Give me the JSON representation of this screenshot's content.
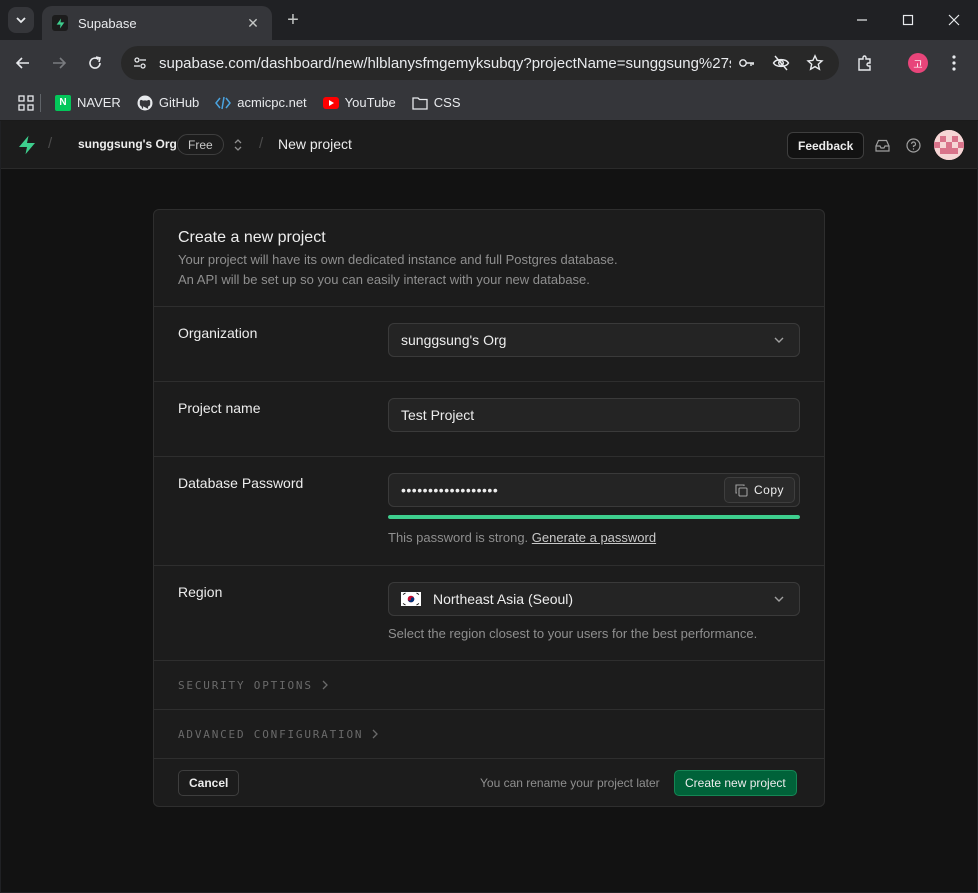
{
  "browser": {
    "tab_title": "Supabase",
    "url": "supabase.com/dashboard/new/hlblanysfmgemyksubqy?projectName=sunggsung%27s%...",
    "profile_initial": "고",
    "bookmarks": [
      {
        "label": "NAVER",
        "icon": "naver-icon"
      },
      {
        "label": "GitHub",
        "icon": "github-icon"
      },
      {
        "label": "acmicpc.net",
        "icon": "code-icon"
      },
      {
        "label": "YouTube",
        "icon": "youtube-icon"
      },
      {
        "label": "CSS",
        "icon": "folder-icon"
      }
    ],
    "naver_glyph": "N"
  },
  "header": {
    "org_name": "sunggsung's Org",
    "plan_badge": "Free",
    "page": "New project",
    "feedback_label": "Feedback"
  },
  "form": {
    "title": "Create a new project",
    "description_line1": "Your project will have its own dedicated instance and full Postgres database.",
    "description_line2": "An API will be set up so you can easily interact with your new database.",
    "organization": {
      "label": "Organization",
      "value": "sunggsung's Org"
    },
    "project_name": {
      "label": "Project name",
      "value": "Test Project"
    },
    "password": {
      "label": "Database Password",
      "masked_value": "••••••••••••••••••",
      "copy_label": "Copy",
      "strength_fraction": 1.0,
      "strength_text": "This password is strong.",
      "generate_link": "Generate a password"
    },
    "region": {
      "label": "Region",
      "value": "Northeast Asia (Seoul)",
      "hint": "Select the region closest to your users for the best performance."
    },
    "security_options": "SECURITY OPTIONS",
    "advanced_configuration": "ADVANCED CONFIGURATION",
    "cancel_label": "Cancel",
    "rename_note": "You can rename your project later",
    "create_label": "Create new project"
  },
  "colors": {
    "brand": "#3ecf8e",
    "primary_button": "#006239",
    "background": "#121212",
    "card": "#1c1c1c"
  }
}
